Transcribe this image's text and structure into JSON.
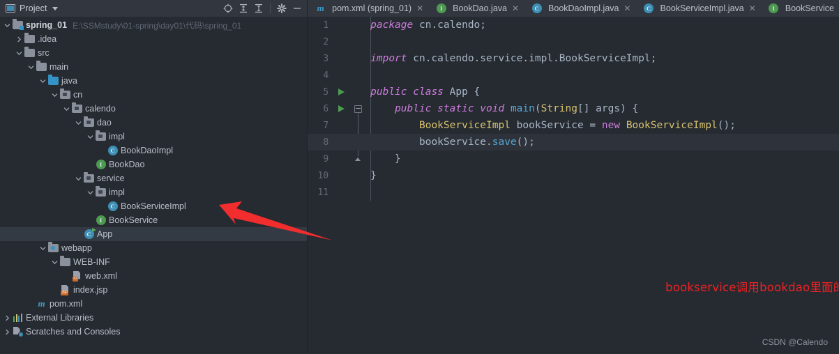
{
  "panel": {
    "title": "Project",
    "title_icon": "project-window-icon",
    "dropdown_icon": "chevron-down-icon",
    "toolbar": [
      {
        "name": "locate-icon",
        "glyph": "crosshair"
      },
      {
        "name": "expand-all-icon",
        "glyph": "expand"
      },
      {
        "name": "collapse-all-icon",
        "glyph": "collapse"
      },
      {
        "name": "settings-gear-icon",
        "glyph": "gear"
      },
      {
        "name": "hide-panel-icon",
        "glyph": "minus"
      }
    ]
  },
  "tree": [
    {
      "label": "spring_01",
      "hint": "E:\\SSMstudy\\01-spring\\day01\\代码\\spring_01",
      "depth": 0,
      "arrow": "down",
      "icon": "project-folder",
      "bold": true,
      "selected": false
    },
    {
      "label": ".idea",
      "hint": "",
      "depth": 1,
      "arrow": "right",
      "icon": "folder",
      "bold": false,
      "selected": false
    },
    {
      "label": "src",
      "hint": "",
      "depth": 1,
      "arrow": "down",
      "icon": "folder",
      "bold": false,
      "selected": false
    },
    {
      "label": "main",
      "hint": "",
      "depth": 2,
      "arrow": "down",
      "icon": "folder",
      "bold": false,
      "selected": false
    },
    {
      "label": "java",
      "hint": "",
      "depth": 3,
      "arrow": "down",
      "icon": "source-folder",
      "bold": false,
      "selected": false
    },
    {
      "label": "cn",
      "hint": "",
      "depth": 4,
      "arrow": "down",
      "icon": "package-folder",
      "bold": false,
      "selected": false
    },
    {
      "label": "calendo",
      "hint": "",
      "depth": 5,
      "arrow": "down",
      "icon": "package-folder",
      "bold": false,
      "selected": false
    },
    {
      "label": "dao",
      "hint": "",
      "depth": 6,
      "arrow": "down",
      "icon": "package-folder",
      "bold": false,
      "selected": false
    },
    {
      "label": "impl",
      "hint": "",
      "depth": 7,
      "arrow": "down",
      "icon": "package-folder",
      "bold": false,
      "selected": false
    },
    {
      "label": "BookDaoImpl",
      "hint": "",
      "depth": 8,
      "arrow": "none",
      "icon": "java-class",
      "bold": false,
      "selected": false
    },
    {
      "label": "BookDao",
      "hint": "",
      "depth": 7,
      "arrow": "none",
      "icon": "java-interface",
      "bold": false,
      "selected": false
    },
    {
      "label": "service",
      "hint": "",
      "depth": 6,
      "arrow": "down",
      "icon": "package-folder",
      "bold": false,
      "selected": false
    },
    {
      "label": "impl",
      "hint": "",
      "depth": 7,
      "arrow": "down",
      "icon": "package-folder",
      "bold": false,
      "selected": false
    },
    {
      "label": "BookServiceImpl",
      "hint": "",
      "depth": 8,
      "arrow": "none",
      "icon": "java-class",
      "bold": false,
      "selected": false
    },
    {
      "label": "BookService",
      "hint": "",
      "depth": 7,
      "arrow": "none",
      "icon": "java-interface",
      "bold": false,
      "selected": false
    },
    {
      "label": "App",
      "hint": "",
      "depth": 6,
      "arrow": "none",
      "icon": "java-class-runnable",
      "bold": false,
      "selected": true
    },
    {
      "label": "webapp",
      "hint": "",
      "depth": 3,
      "arrow": "down",
      "icon": "webapp-folder",
      "bold": false,
      "selected": false
    },
    {
      "label": "WEB-INF",
      "hint": "",
      "depth": 4,
      "arrow": "down",
      "icon": "folder",
      "bold": false,
      "selected": false
    },
    {
      "label": "web.xml",
      "hint": "",
      "depth": 5,
      "arrow": "none",
      "icon": "xml-file",
      "bold": false,
      "selected": false
    },
    {
      "label": "index.jsp",
      "hint": "",
      "depth": 4,
      "arrow": "none",
      "icon": "jsp-file",
      "bold": false,
      "selected": false
    },
    {
      "label": "pom.xml",
      "hint": "",
      "depth": 2,
      "arrow": "none",
      "icon": "maven-file",
      "bold": false,
      "selected": false
    },
    {
      "label": "External Libraries",
      "hint": "",
      "depth": 0,
      "arrow": "right",
      "icon": "libraries",
      "bold": false,
      "selected": false
    },
    {
      "label": "Scratches and Consoles",
      "hint": "",
      "depth": 0,
      "arrow": "right",
      "icon": "scratches",
      "bold": false,
      "selected": false
    }
  ],
  "tabs": [
    {
      "label": "pom.xml (spring_01)",
      "icon": "maven-file",
      "active": true,
      "closable": true
    },
    {
      "label": "BookDao.java",
      "icon": "java-interface",
      "active": false,
      "closable": true
    },
    {
      "label": "BookDaoImpl.java",
      "icon": "java-class",
      "active": false,
      "closable": true
    },
    {
      "label": "BookServiceImpl.java",
      "icon": "java-class",
      "active": false,
      "closable": true
    },
    {
      "label": "BookService",
      "icon": "java-interface",
      "active": false,
      "closable": false
    }
  ],
  "code": {
    "lines": [
      {
        "n": "1",
        "run": false,
        "caret": false,
        "tokens": [
          {
            "t": "package",
            "c": "kw"
          },
          {
            "t": " cn.calendo;",
            "c": "plain"
          }
        ]
      },
      {
        "n": "2",
        "run": false,
        "caret": false,
        "tokens": []
      },
      {
        "n": "3",
        "run": false,
        "caret": false,
        "tokens": [
          {
            "t": "import",
            "c": "kw"
          },
          {
            "t": " cn.calendo.service.impl.BookServiceImpl;",
            "c": "plain"
          }
        ]
      },
      {
        "n": "4",
        "run": false,
        "caret": false,
        "tokens": []
      },
      {
        "n": "5",
        "run": true,
        "caret": false,
        "tokens": [
          {
            "t": "public class",
            "c": "kw"
          },
          {
            "t": " App {",
            "c": "plain"
          }
        ]
      },
      {
        "n": "6",
        "run": true,
        "caret": false,
        "tokens": [
          {
            "t": "    ",
            "c": "plain"
          },
          {
            "t": "public static void",
            "c": "kw"
          },
          {
            "t": " ",
            "c": "plain"
          },
          {
            "t": "main",
            "c": "mth"
          },
          {
            "t": "(",
            "c": "pun"
          },
          {
            "t": "String",
            "c": "typ"
          },
          {
            "t": "[] args) {",
            "c": "plain"
          }
        ]
      },
      {
        "n": "7",
        "run": false,
        "caret": false,
        "tokens": [
          {
            "t": "        ",
            "c": "plain"
          },
          {
            "t": "BookServiceImpl",
            "c": "typ"
          },
          {
            "t": " bookService = ",
            "c": "plain"
          },
          {
            "t": "new",
            "c": "kw2"
          },
          {
            "t": " ",
            "c": "plain"
          },
          {
            "t": "BookServiceImpl",
            "c": "typ"
          },
          {
            "t": "();",
            "c": "plain"
          }
        ]
      },
      {
        "n": "8",
        "run": false,
        "caret": true,
        "tokens": [
          {
            "t": "        bookService.",
            "c": "plain"
          },
          {
            "t": "save",
            "c": "mth"
          },
          {
            "t": "();",
            "c": "plain"
          }
        ]
      },
      {
        "n": "9",
        "run": false,
        "caret": false,
        "tokens": [
          {
            "t": "    }",
            "c": "plain"
          }
        ]
      },
      {
        "n": "10",
        "run": false,
        "caret": false,
        "tokens": [
          {
            "t": "}",
            "c": "plain"
          }
        ]
      },
      {
        "n": "11",
        "run": false,
        "caret": false,
        "tokens": []
      }
    ]
  },
  "annotation": {
    "text": "bookservice调用bookdao里面的.save方法，然后在主类里面使用",
    "color": "#ee2222",
    "arrow_name": "red-pointer-arrow"
  },
  "watermark": "CSDN @Calendo",
  "colors": {
    "panel_bg": "#262a31",
    "header_bg": "#31363f",
    "selection": "#343a44",
    "keyword": "#cc7ddd",
    "type": "#d8c471",
    "method": "#54a8d6",
    "text": "#a9b7c6",
    "accent_red": "#ee2222"
  }
}
